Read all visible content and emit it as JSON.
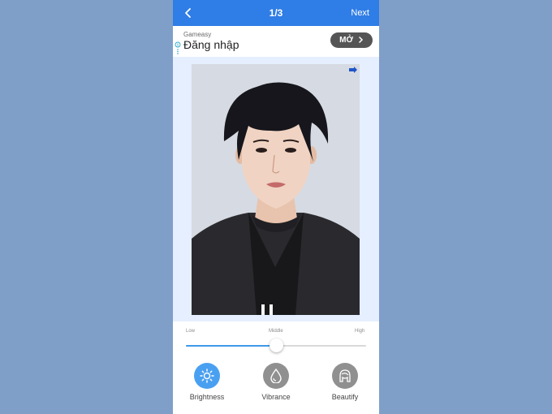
{
  "header": {
    "title": "1/3",
    "next_label": "Next"
  },
  "ad": {
    "brand": "Gameasy",
    "title": "Đăng nhập",
    "button_label": "MỞ"
  },
  "slider": {
    "low": "Low",
    "middle": "Middle",
    "high": "High",
    "value_fraction": 0.5
  },
  "tools": [
    {
      "label": "Brightness",
      "icon": "sun-icon",
      "active": true
    },
    {
      "label": "Vibrance",
      "icon": "droplet-icon",
      "active": false
    },
    {
      "label": "Beautify",
      "icon": "face-icon",
      "active": false
    }
  ],
  "colors": {
    "accent": "#2f7de6",
    "slider": "#3f9ae8",
    "background": "#7f9fc8"
  }
}
